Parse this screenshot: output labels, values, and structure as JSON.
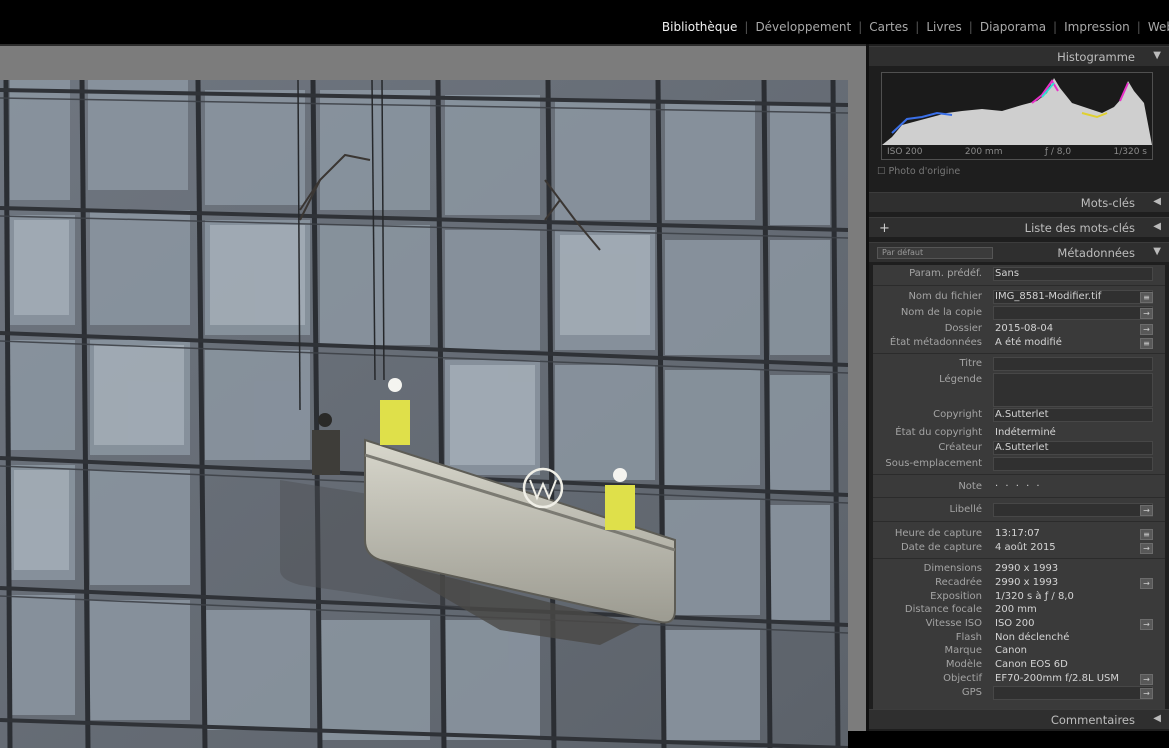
{
  "modules": [
    "Bibliothèque",
    "Développement",
    "Cartes",
    "Livres",
    "Diaporama",
    "Impression",
    "Web"
  ],
  "active_module": "Bibliothèque",
  "histogram": {
    "title": "Histogramme",
    "iso": "ISO 200",
    "focal": "200 mm",
    "aperture": "ƒ / 8,0",
    "shutter": "1/320 s",
    "original": "Photo d'origine"
  },
  "panels": {
    "keywords": "Mots-clés",
    "keyword_list": "Liste des mots-clés",
    "metadata": "Métadonnées",
    "comments": "Commentaires",
    "preset_dropdown": "Par défaut"
  },
  "metadata": {
    "preset_label": "Param. prédéf.",
    "preset_value": "Sans",
    "filename_label": "Nom du fichier",
    "filename": "IMG_8581-Modifier.tif",
    "copyname_label": "Nom de la copie",
    "copyname": "",
    "folder_label": "Dossier",
    "folder": "2015-08-04",
    "state_label": "État métadonnées",
    "state": "A été modifié",
    "title_label": "Titre",
    "caption_label": "Légende",
    "copyright_label": "Copyright",
    "copyright": "A.Sutterlet",
    "copyright_state_label": "État du copyright",
    "copyright_state": "Indéterminé",
    "creator_label": "Créateur",
    "creator": "A.Sutterlet",
    "sublocation_label": "Sous-emplacement",
    "note_label": "Note",
    "note": "· · · · ·",
    "libelle_label": "Libellé",
    "capture_time_label": "Heure de capture",
    "capture_time": "13:17:07",
    "capture_date_label": "Date de capture",
    "capture_date": "4 août 2015",
    "dimensions_label": "Dimensions",
    "dimensions": "2990 x 1993",
    "crop_label": "Recadrée",
    "crop": "2990 x 1993",
    "exposure_label": "Exposition",
    "exposure": "1/320 s à ƒ / 8,0",
    "focal_label": "Distance focale",
    "focal": "200 mm",
    "iso_label": "Vitesse ISO",
    "iso": "ISO 200",
    "flash_label": "Flash",
    "flash": "Non déclenché",
    "make_label": "Marque",
    "make": "Canon",
    "model_label": "Modèle",
    "model": "Canon EOS 6D",
    "lens_label": "Objectif",
    "lens": "EF70-200mm f/2.8L USM",
    "gps_label": "GPS",
    "gps": ""
  },
  "colors": {
    "panel_bg": "#1e1e1e",
    "header_bg": "#2f2f2f",
    "meta_bg": "#3a3a3a",
    "viewer_bg": "#7c7c7c"
  }
}
